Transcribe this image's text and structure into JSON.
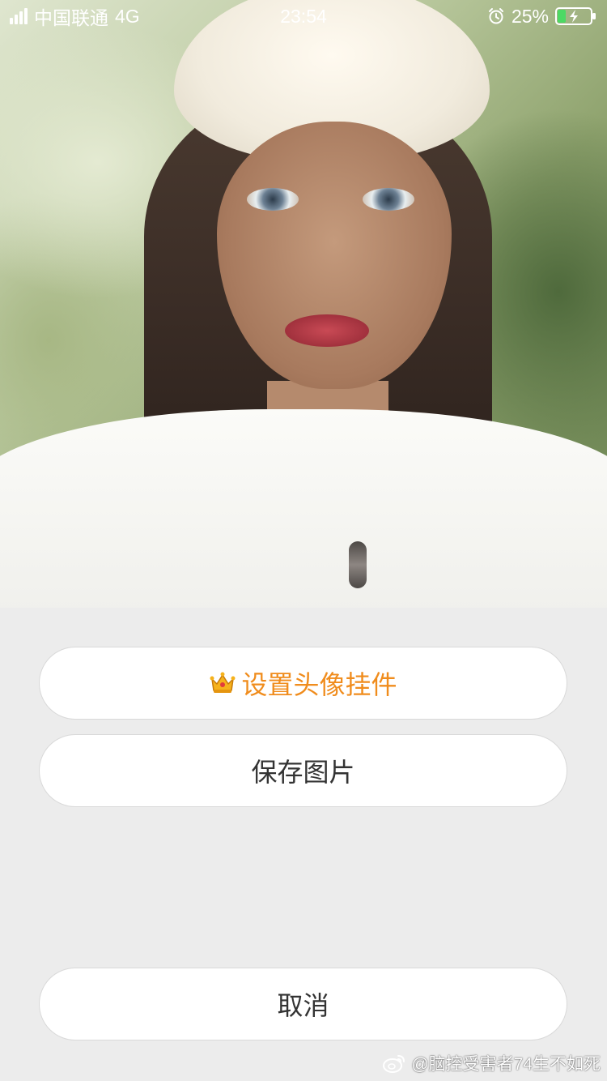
{
  "status_bar": {
    "carrier": "中国联通",
    "network": "4G",
    "time": "23:54",
    "battery_percent": "25%",
    "battery_level": 0.25
  },
  "photo": {
    "description_icon": "profile-photo"
  },
  "actions": {
    "set_avatar_widget_label": "设置头像挂件",
    "save_image_label": "保存图片",
    "cancel_label": "取消"
  },
  "watermark": {
    "text": "@脑控受害者74生不如死"
  },
  "colors": {
    "accent_orange": "#f08c1c",
    "button_text": "#333333",
    "sheet_background": "#ececec",
    "battery_charge": "#4cd964"
  }
}
